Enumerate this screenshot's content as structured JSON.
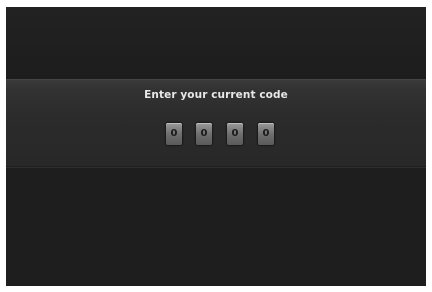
{
  "prompt": "Enter your current code",
  "code_digits": [
    "0",
    "0",
    "0",
    "0"
  ],
  "colors": {
    "background": "#1f1f1f",
    "band": "#2f2f2f",
    "text": "#e8e8e8",
    "digit_box": "#7a7a7a"
  }
}
